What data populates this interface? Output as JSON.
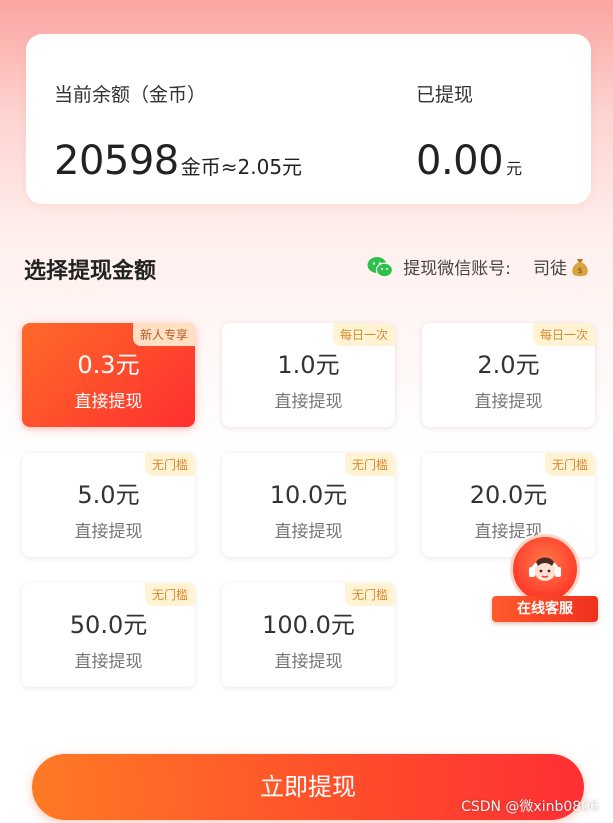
{
  "balance": {
    "current_label": "当前余额（金币）",
    "current_value": "20598",
    "current_unit": "金币≈2.05元",
    "withdrawn_label": "已提现",
    "withdrawn_value": "0.00",
    "withdrawn_unit": "元"
  },
  "section": {
    "title": "选择提现金额",
    "wechat_label": "提现微信账号:",
    "wechat_account": "司徒"
  },
  "options": [
    {
      "amount": "0.3元",
      "sub": "直接提现",
      "tag": "新人专享",
      "selected": true
    },
    {
      "amount": "1.0元",
      "sub": "直接提现",
      "tag": "每日一次",
      "selected": false
    },
    {
      "amount": "2.0元",
      "sub": "直接提现",
      "tag": "每日一次",
      "selected": false
    },
    {
      "amount": "5.0元",
      "sub": "直接提现",
      "tag": "无门槛",
      "selected": false
    },
    {
      "amount": "10.0元",
      "sub": "直接提现",
      "tag": "无门槛",
      "selected": false
    },
    {
      "amount": "20.0元",
      "sub": "直接提现",
      "tag": "无门槛",
      "selected": false
    },
    {
      "amount": "50.0元",
      "sub": "直接提现",
      "tag": "无门槛",
      "selected": false
    },
    {
      "amount": "100.0元",
      "sub": "直接提现",
      "tag": "无门槛",
      "selected": false
    }
  ],
  "service": {
    "label": "在线客服"
  },
  "submit": {
    "label": "立即提现"
  },
  "watermark": "CSDN @微xinb0806",
  "colors": {
    "accent": "#ff4b2b",
    "tag_bg": "#fff3d4",
    "tag_text": "#d9892c",
    "wechat_green": "#2ec24a"
  },
  "icons": {
    "wechat": "wechat-icon",
    "money_bag": "money-bag-icon",
    "customer_service": "headset-agent-icon"
  }
}
